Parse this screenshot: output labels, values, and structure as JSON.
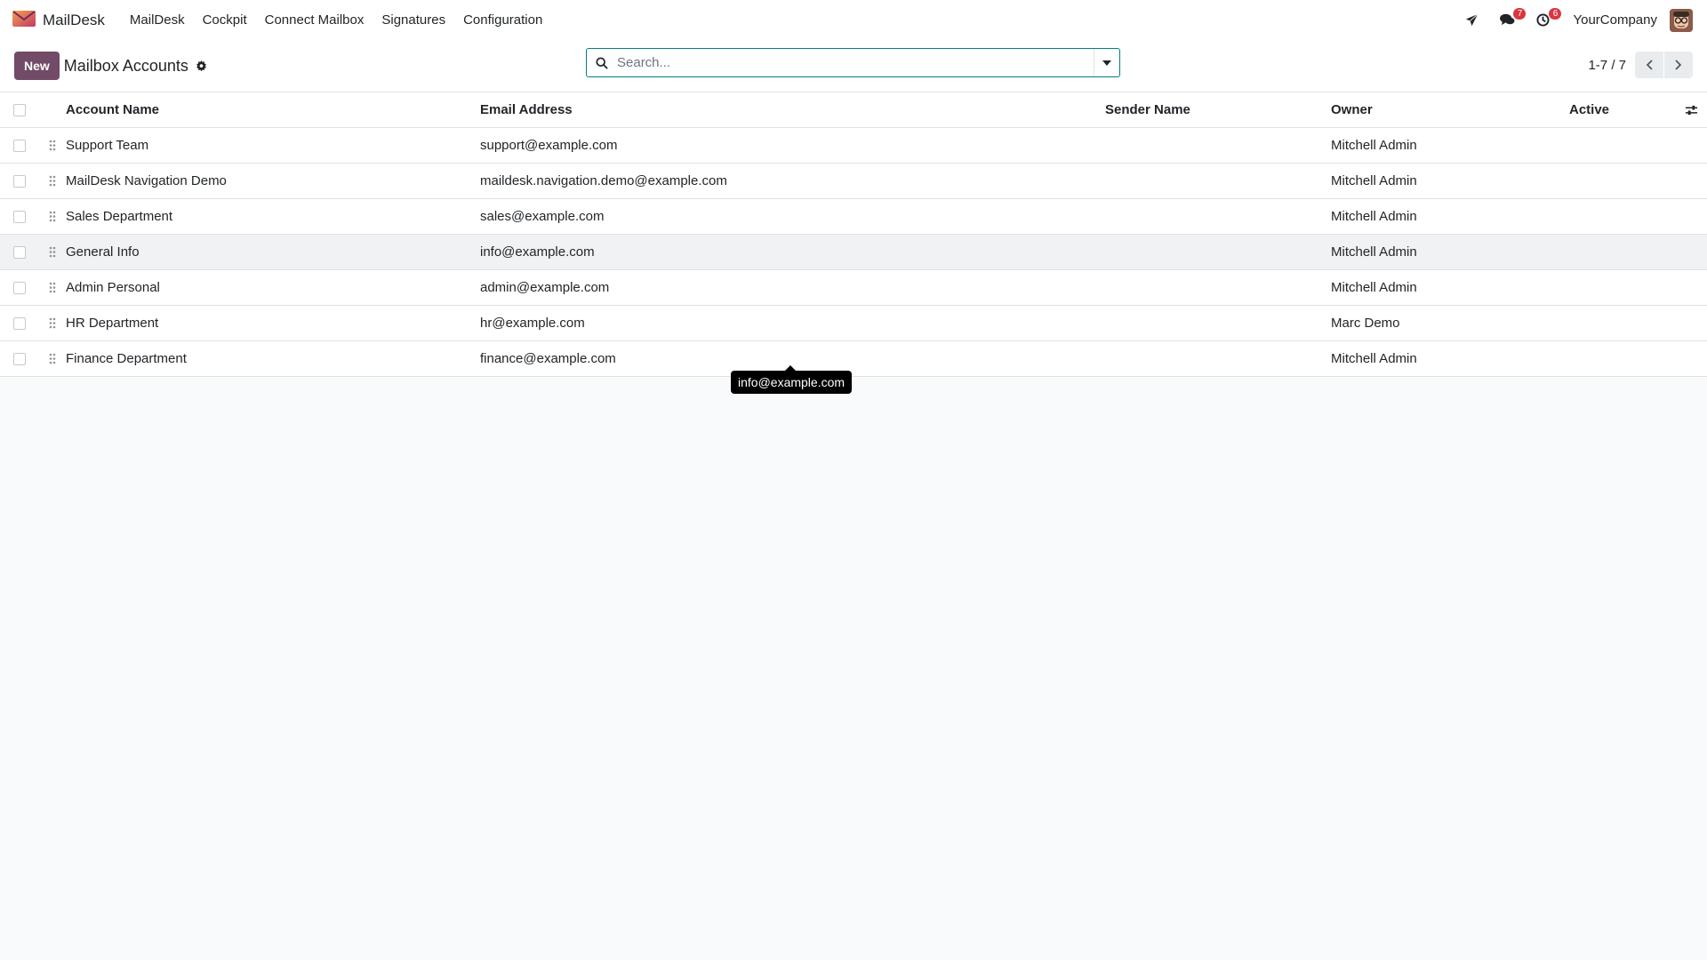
{
  "navbar": {
    "app_name": "MailDesk",
    "menu": [
      {
        "label": "MailDesk"
      },
      {
        "label": "Cockpit"
      },
      {
        "label": "Connect Mailbox"
      },
      {
        "label": "Signatures"
      },
      {
        "label": "Configuration"
      }
    ],
    "messages_count": "7",
    "activities_count": "6",
    "company": "YourCompany"
  },
  "control_panel": {
    "new_label": "New",
    "title": "Mailbox Accounts",
    "search_placeholder": "Search...",
    "pager": "1-7 / 7"
  },
  "table": {
    "columns": {
      "name": "Account Name",
      "email": "Email Address",
      "sender": "Sender Name",
      "owner": "Owner",
      "active": "Active"
    },
    "rows": [
      {
        "name": "Support Team",
        "email": "support@example.com",
        "sender": "",
        "owner": "Mitchell Admin",
        "active": true
      },
      {
        "name": "MailDesk Navigation Demo",
        "email": "maildesk.navigation.demo@example.com",
        "sender": "",
        "owner": "Mitchell Admin",
        "active": true
      },
      {
        "name": "Sales Department",
        "email": "sales@example.com",
        "sender": "",
        "owner": "Mitchell Admin",
        "active": true
      },
      {
        "name": "General Info",
        "email": "info@example.com",
        "sender": "",
        "owner": "Mitchell Admin",
        "active": true
      },
      {
        "name": "Admin Personal",
        "email": "admin@example.com",
        "sender": "",
        "owner": "Mitchell Admin",
        "active": true
      },
      {
        "name": "HR Department",
        "email": "hr@example.com",
        "sender": "",
        "owner": "Marc Demo",
        "active": true
      },
      {
        "name": "Finance Department",
        "email": "finance@example.com",
        "sender": "",
        "owner": "Mitchell Admin",
        "active": true
      }
    ]
  },
  "tooltip": {
    "text": "info@example.com"
  },
  "colors": {
    "brand": "#714b67",
    "search_border": "#017e84",
    "toggle_on": "#28a745",
    "badge": "#d9363e"
  }
}
